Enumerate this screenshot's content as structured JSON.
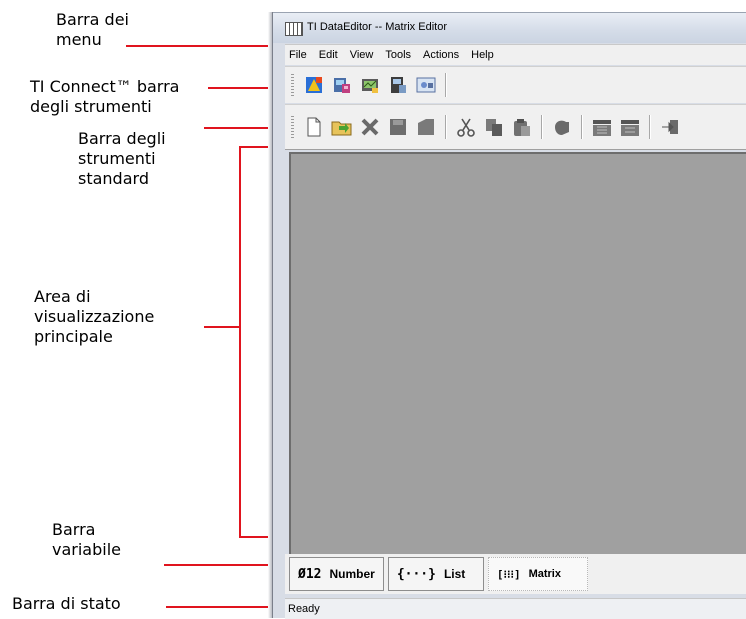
{
  "annotations": {
    "menu_bar": [
      "Barra dei",
      "menu"
    ],
    "ti_connect_toolbar": [
      "TI Connect™ barra",
      "degli strumenti"
    ],
    "standard_toolbar": [
      "Barra degli",
      "strumenti",
      "standard"
    ],
    "main_area": [
      "Area di",
      "visualizzazione",
      "principale"
    ],
    "variable_bar": [
      "Barra",
      "variabile"
    ],
    "status_bar": [
      "Barra di stato"
    ]
  },
  "window": {
    "title": "TI DataEditor -- Matrix Editor"
  },
  "menubar": {
    "items": [
      "File",
      "Edit",
      "View",
      "Tools",
      "Actions",
      "Help"
    ]
  },
  "ti_connect_toolbar": {
    "icons": [
      "ti-connect-icon",
      "device-explorer-icon",
      "screen-capture-icon",
      "backup-icon",
      "device-info-icon"
    ]
  },
  "standard_toolbar": {
    "icons": [
      "new-file-icon",
      "open-folder-icon",
      "delete-icon",
      "save-icon",
      "save-as-icon",
      "cut-icon",
      "copy-icon",
      "paste-icon",
      "send-icon",
      "column-insert-icon",
      "column-delete-icon",
      "import-icon"
    ]
  },
  "variable_bar": {
    "tabs": [
      {
        "icon": "Ø12",
        "label": "Number"
      },
      {
        "icon": "{···}",
        "label": "List"
      },
      {
        "icon": "[⁝⁝⁝]",
        "label": "Matrix"
      }
    ],
    "active": "Matrix"
  },
  "statusbar": {
    "text": "Ready"
  },
  "colors": {
    "annotation_line": "#e0141e",
    "main_area": "#a0a0a0",
    "toolbar": "#f0f0f0"
  }
}
